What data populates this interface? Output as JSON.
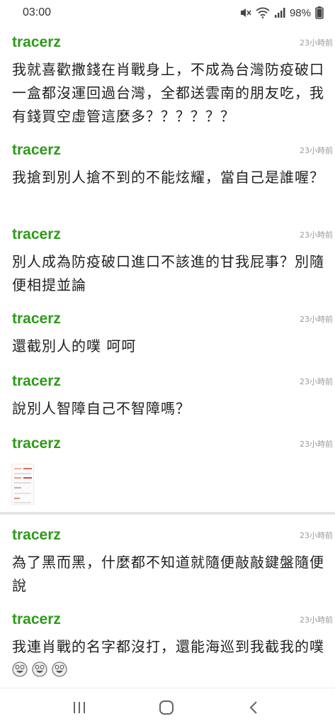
{
  "status_bar": {
    "time": "03:00",
    "battery": "98%"
  },
  "comments": [
    {
      "user": "tracerz",
      "time": "23小時前",
      "text": "我就喜歡撒錢在肖戰身上，不成為台灣防疫破口一盒都沒運回過台灣，全都送雲南的朋友吃，我有錢買空虛管這麼多？？？？？？"
    },
    {
      "user": "tracerz",
      "time": "23小時前",
      "text": "我搶到別人搶不到的不能炫耀，當自己是誰喔？"
    },
    {
      "user": "tracerz",
      "time": "23小時前",
      "text": "別人成為防疫破口進口不該進的甘我屁事？別隨便相提並論"
    },
    {
      "user": "tracerz",
      "time": "23小時前",
      "text": "還截別人的噗 呵呵"
    },
    {
      "user": "tracerz",
      "time": "23小時前",
      "text": "說別人智障自己不智障嗎？"
    },
    {
      "user": "tracerz",
      "time": "23小時前",
      "text": ""
    },
    {
      "user": "tracerz",
      "time": "23小時前",
      "text": "為了黑而黑，什麼都不知道就隨便敲敲鍵盤隨便說"
    },
    {
      "user": "tracerz",
      "time": "23小時前",
      "text": "我連肖戰的名字都沒打，還能海巡到我截我的噗"
    }
  ],
  "colors": {
    "username": "#2e9a1a",
    "timestamp": "#9a9a9a",
    "divider": "#e4e4e4"
  },
  "icons": {
    "status": [
      "mute-icon",
      "wifi-icon",
      "signal-icon"
    ],
    "comment_8_emoji": [
      "laughing-face-icon",
      "laughing-face-icon",
      "laughing-face-icon"
    ],
    "nav": [
      "recent-apps-icon",
      "home-icon",
      "back-icon"
    ]
  }
}
